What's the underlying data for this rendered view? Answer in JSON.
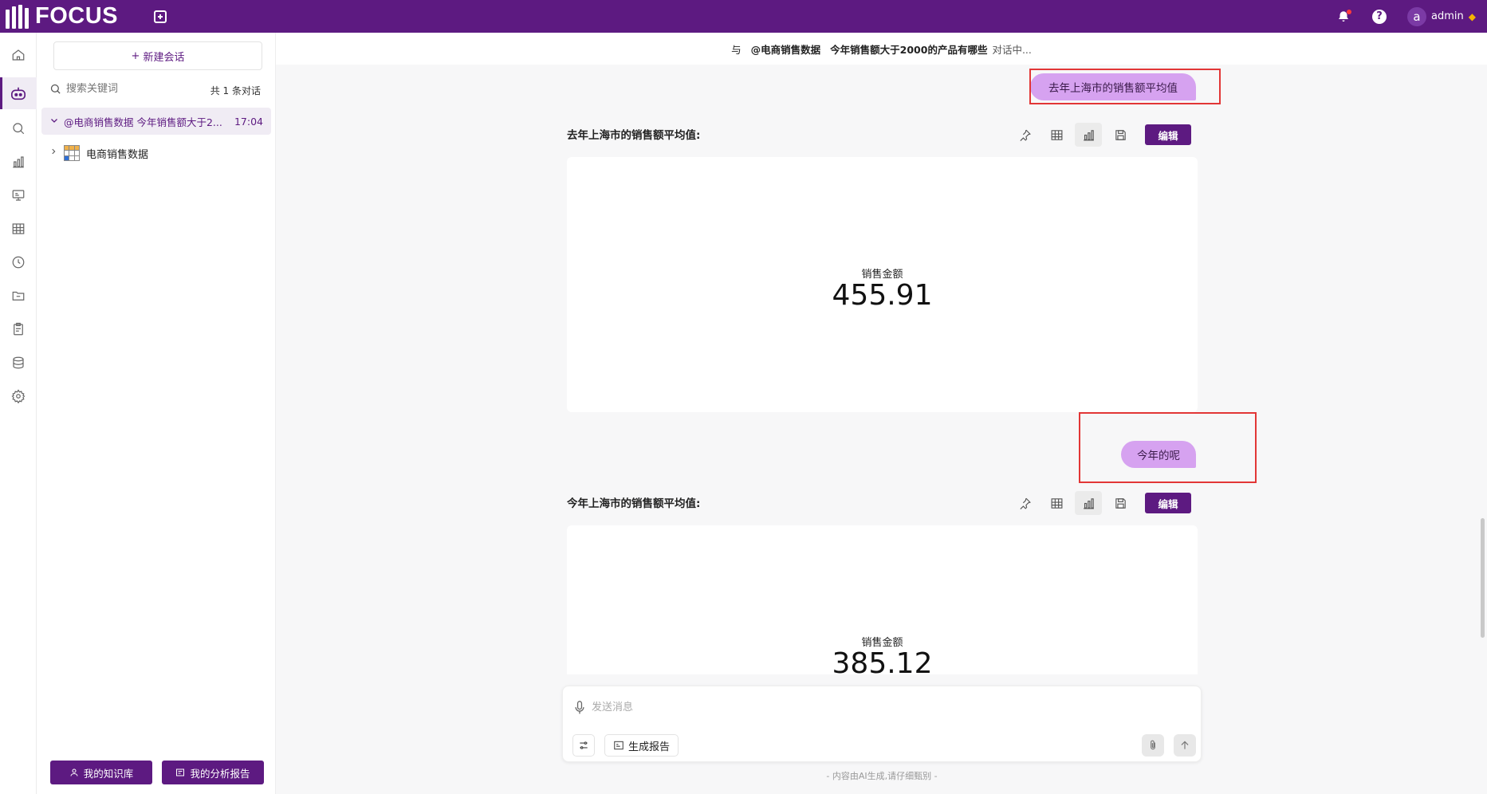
{
  "app": {
    "logo_text": "FOCUS",
    "user_initial": "a",
    "user_name": "admin",
    "brand_color": "#5d1a81"
  },
  "rail": {
    "items": [
      "home-icon",
      "chatbot-icon",
      "search-icon",
      "chart-icon",
      "presentation-icon",
      "table-icon",
      "clock-icon",
      "folder-icon",
      "clipboard-icon",
      "database-icon",
      "gear-icon"
    ],
    "active_index": 1
  },
  "sidebar": {
    "new_chat_label": "新建会话",
    "search_placeholder": "搜索关键词",
    "count_label": "共 1 条对话",
    "conversation": {
      "title": "@电商销售数据 今年销售额大于2...",
      "time": "17:04"
    },
    "dataset_name": "电商销售数据",
    "knowledge_button": "我的知识库",
    "reports_button": "我的分析报告"
  },
  "header": {
    "prefix": "与",
    "mention": "@电商销售数据",
    "question": "今年销售额大于2000的产品有哪些",
    "status": "对话中..."
  },
  "messages": [
    {
      "user_text": "去年上海市的销售额平均值",
      "answer_title": "去年上海市的销售额平均值:",
      "kpi_label": "销售金额",
      "kpi_value": "455.91"
    },
    {
      "user_text": "今年的呢",
      "answer_title": "今年上海市的销售额平均值:",
      "kpi_label": "销售金额",
      "kpi_value": "385.12"
    }
  ],
  "toolbar": {
    "edit_label": "编辑"
  },
  "composer": {
    "placeholder": "发送消息",
    "report_label": "生成报告"
  },
  "disclaimer": "- 内容由AI生成,请仔细甄别 -"
}
